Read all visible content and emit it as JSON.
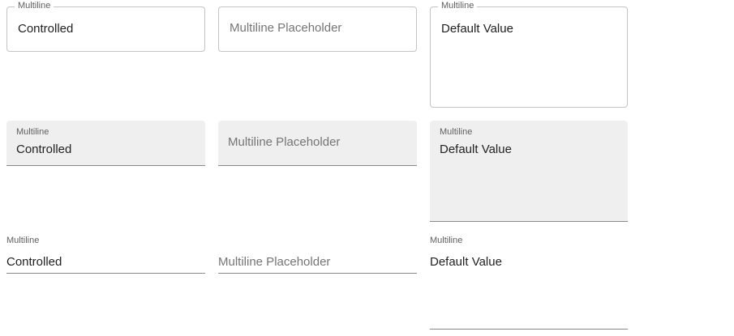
{
  "outlined": {
    "controlled": {
      "label": "Multiline",
      "value": "Controlled"
    },
    "placeholder": {
      "placeholder": "Multiline Placeholder"
    },
    "default": {
      "label": "Multiline",
      "value": "Default Value"
    }
  },
  "filled": {
    "controlled": {
      "label": "Multiline",
      "value": "Controlled"
    },
    "placeholder": {
      "placeholder": "Multiline Placeholder"
    },
    "default": {
      "label": "Multiline",
      "value": "Default Value"
    }
  },
  "standard": {
    "controlled": {
      "label": "Multiline",
      "value": "Controlled"
    },
    "placeholder": {
      "placeholder": "Multiline Placeholder"
    },
    "default": {
      "label": "Multiline",
      "value": "Default Value"
    }
  },
  "colors": {
    "outline_border": "#c4c4c4",
    "filled_background": "#efefef",
    "underline": "#8a8a8a",
    "label_text": "#5f5f5f",
    "placeholder_text": "#757575",
    "value_text": "#222222"
  }
}
